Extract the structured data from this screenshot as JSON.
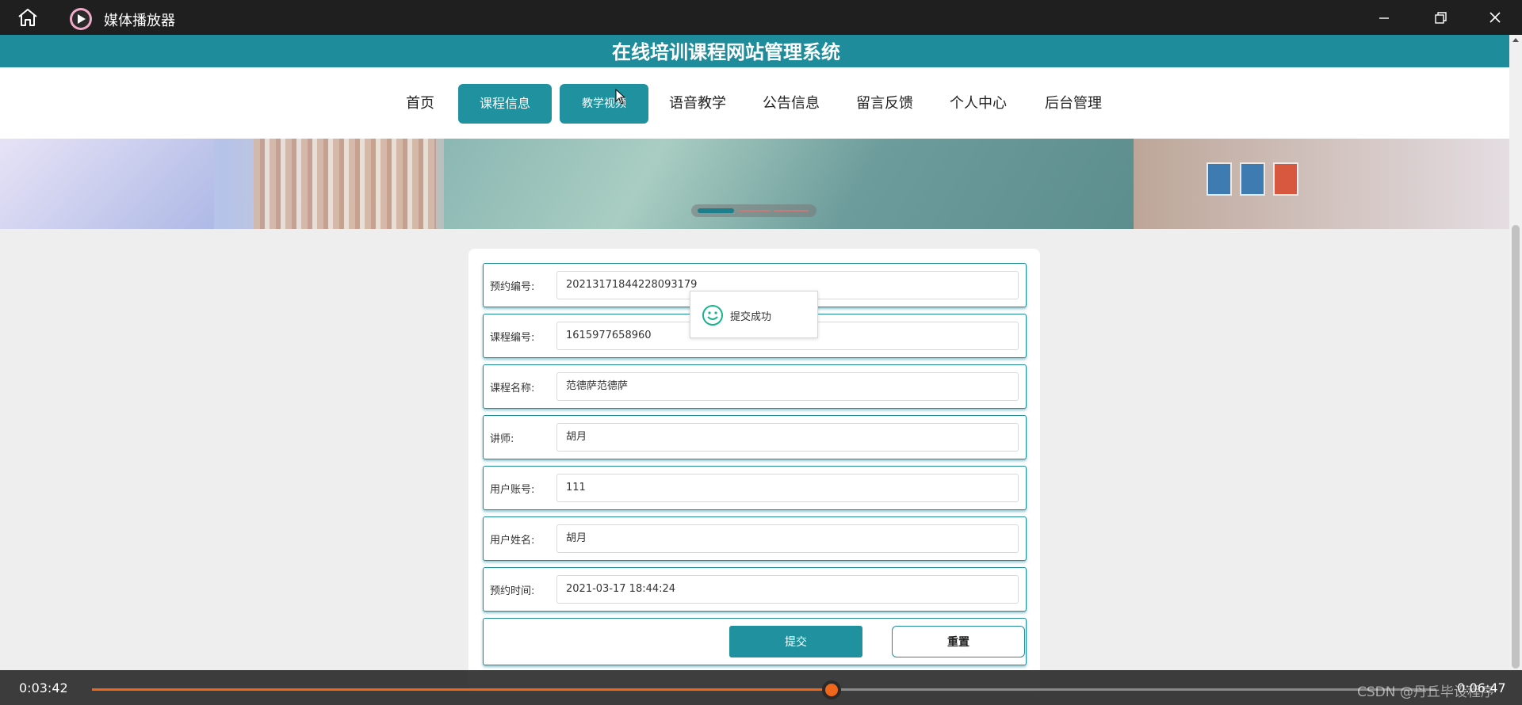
{
  "window": {
    "title": "媒体播放器",
    "controls": {
      "minimize": "minimize-icon",
      "maximize": "restore-icon",
      "close": "close-icon"
    }
  },
  "site": {
    "title": "在线培训课程网站管理系统"
  },
  "nav": {
    "items": [
      {
        "label": "首页",
        "active": false
      },
      {
        "label": "课程信息",
        "active": true
      },
      {
        "label": "教学视频",
        "active": true
      },
      {
        "label": "语音教学",
        "active": false
      },
      {
        "label": "公告信息",
        "active": false
      },
      {
        "label": "留言反馈",
        "active": false
      },
      {
        "label": "个人中心",
        "active": false
      },
      {
        "label": "后台管理",
        "active": false
      }
    ]
  },
  "carousel": {
    "slides": 3,
    "current": 1
  },
  "form": {
    "fields": [
      {
        "label": "预约编号:",
        "value": "20213171844228093179"
      },
      {
        "label": "课程编号:",
        "value": "1615977658960"
      },
      {
        "label": "课程名称:",
        "value": "范德萨范德萨"
      },
      {
        "label": "讲师:",
        "value": "胡月"
      },
      {
        "label": "用户账号:",
        "value": "111"
      },
      {
        "label": "用户姓名:",
        "value": "胡月"
      },
      {
        "label": "预约时间:",
        "value": "2021-03-17 18:44:24"
      }
    ],
    "submit_label": "提交",
    "reset_label": "重置"
  },
  "toast": {
    "message": "提交成功",
    "icon": "smile-icon"
  },
  "player": {
    "current_time": "0:03:42",
    "total_time": "0:06:47",
    "progress": 0.55,
    "watermark": "CSDN @丹丘毕设程序"
  },
  "colors": {
    "accent": "#20929f",
    "header": "#1e8c9b",
    "progress": "#f0661a",
    "titlebar": "#1f1f1f"
  }
}
